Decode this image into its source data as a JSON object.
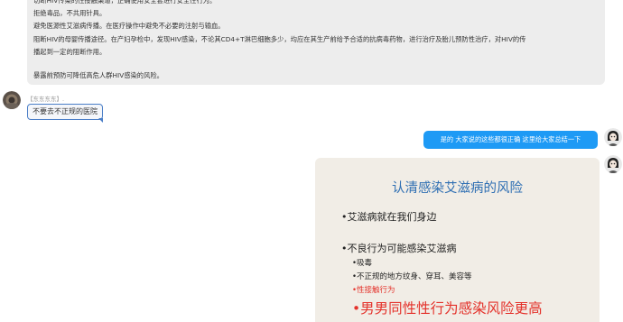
{
  "chat": {
    "top_message_lines": [
      "切断HIV传染的性接触渠道，正确使用安全套进行安全性行为。",
      "拒绝毒品，不共用针具。",
      "避免医源性艾滋病传播。在医疗操作中避免不必要的注射与输血。",
      "阻断HIV的母婴传播途径。在产妇孕检中，发现HIV感染，不论其CD4+T淋巴细胞多少，均应在其生产前给予合适的抗病毒药物，进行治疗及胎儿预防性治疗，对HIV的传",
      "播起到一定的阻断作用。",
      "",
      "暴露前预防可降低高危人群HIV感染的风险。"
    ],
    "reply": {
      "sender": "【东东东东】.",
      "text": "不要去不正规的医院"
    },
    "sent_message": "是的 大家说的这些都很正确 这里给大家总结一下",
    "slide": {
      "title": "认清感染艾滋病的风险",
      "line1": "•艾滋病就在我们身边",
      "line2": "•不良行为可能感染艾滋病",
      "sub1": "•吸毒",
      "sub2": "•不正规的地方纹身、穿耳、美容等",
      "sub3": "•性接触行为",
      "highlight": "•男男同性性行为感染风险更高"
    }
  },
  "colors": {
    "received_bubble": "#ededed",
    "sent_bubble": "#1e9af5",
    "reply_border": "#4a7ec7",
    "slide_title": "#2f6fb3",
    "slide_red": "#e4322b"
  }
}
